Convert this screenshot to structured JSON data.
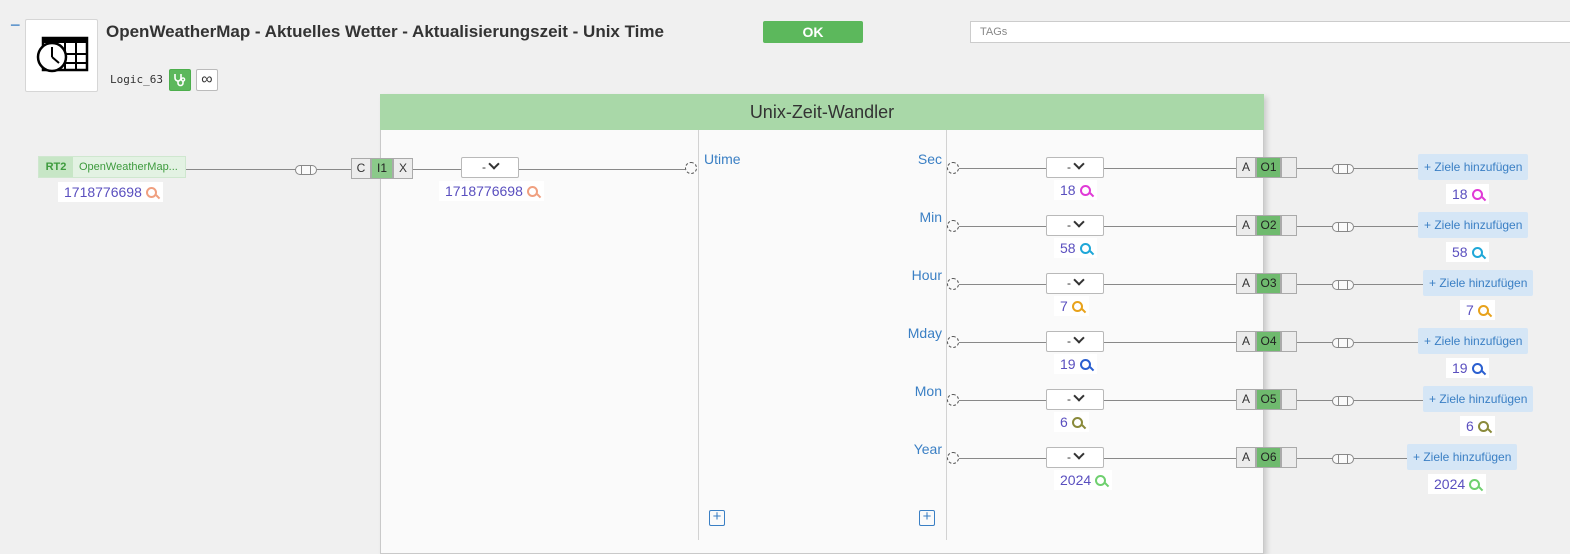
{
  "header": {
    "collapse": "−",
    "title": "OpenWeatherMap - Aktuelles Wetter - Aktualisierungszeit - Unix Time",
    "ok_label": "OK",
    "tags_placeholder": "TAGs",
    "logic_id": "Logic_63",
    "infinity": "∞"
  },
  "block": {
    "title": "Unix-Zeit-Wandler"
  },
  "input": {
    "source_key": "RT2",
    "source_name": "OpenWeatherMap...",
    "source_value": "1718776698",
    "connector": {
      "c": "C",
      "i": "I1",
      "x": "X"
    },
    "dropdown": "-",
    "value": "1718776698",
    "port_label": "Utime"
  },
  "outputs": [
    {
      "label": "Sec",
      "dropdown": "-",
      "value": "18",
      "a": "A",
      "o": "O1",
      "target": "Ziele hinzufügen",
      "target_value": "18",
      "color": "#e03ad6"
    },
    {
      "label": "Min",
      "dropdown": "-",
      "value": "58",
      "a": "A",
      "o": "O2",
      "target": "Ziele hinzufügen",
      "target_value": "58",
      "color": "#1fa7d8"
    },
    {
      "label": "Hour",
      "dropdown": "-",
      "value": "7",
      "a": "A",
      "o": "O3",
      "target": "Ziele hinzufügen",
      "target_value": "7",
      "color": "#e8a21a"
    },
    {
      "label": "Mday",
      "dropdown": "-",
      "value": "19",
      "a": "A",
      "o": "O4",
      "target": "Ziele hinzufügen",
      "target_value": "19",
      "color": "#2a5fd0"
    },
    {
      "label": "Mon",
      "dropdown": "-",
      "value": "6",
      "a": "A",
      "o": "O5",
      "target": "Ziele hinzufügen",
      "target_value": "6",
      "color": "#8a8a3a"
    },
    {
      "label": "Year",
      "dropdown": "-",
      "value": "2024",
      "a": "A",
      "o": "O6",
      "target": "Ziele hinzufügen",
      "target_value": "2024",
      "color": "#6fd06f"
    }
  ],
  "colors": {
    "input_mag": "#f0a080",
    "accent": "#5cb85c",
    "link": "#3a7fc4"
  }
}
